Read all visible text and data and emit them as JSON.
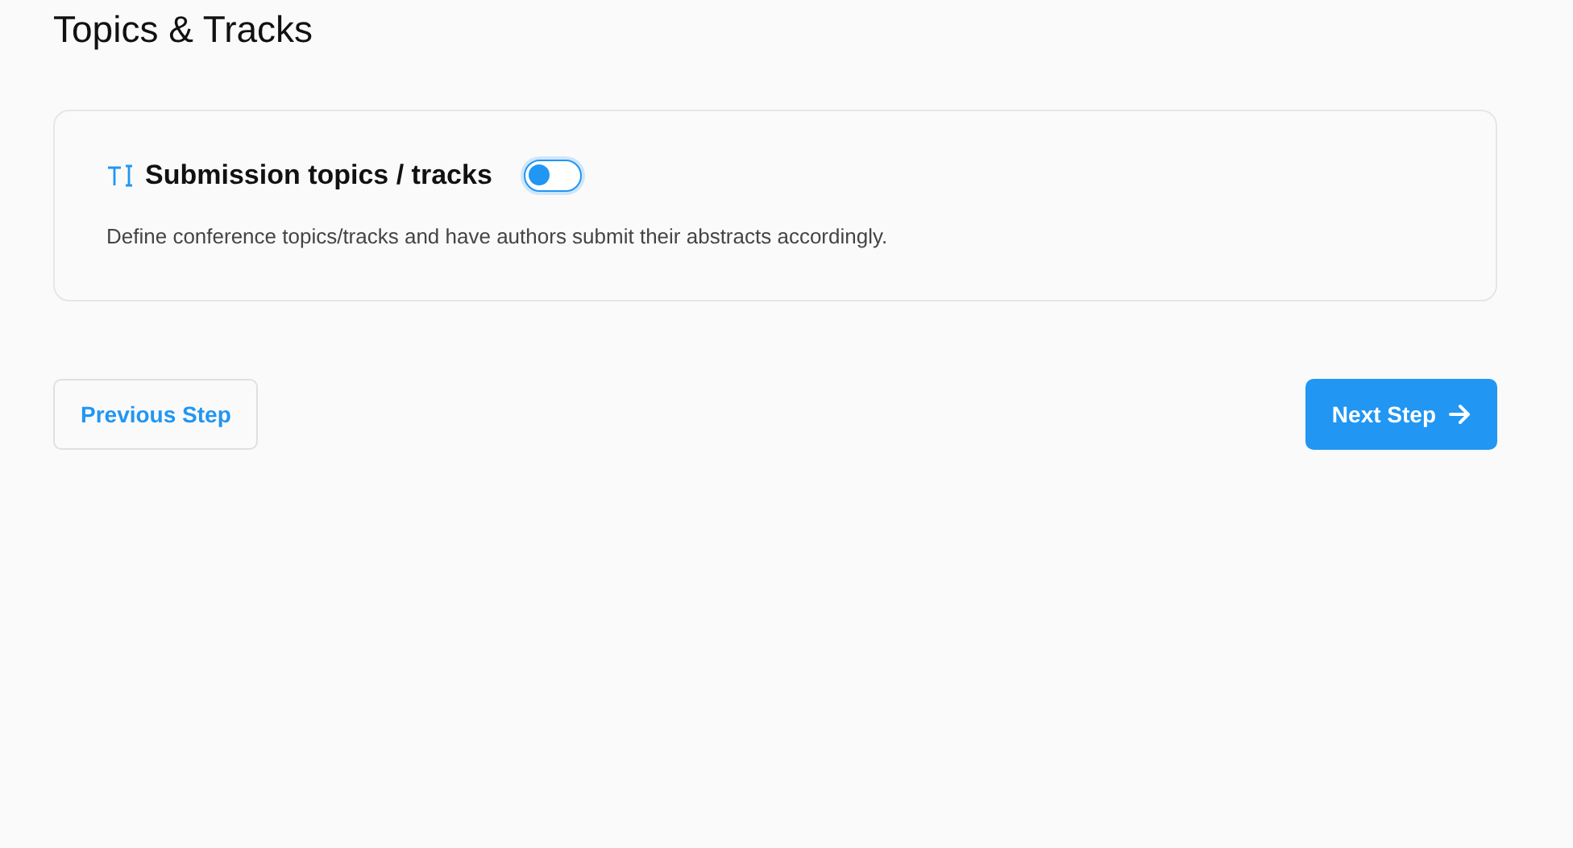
{
  "page_title": "Topics & Tracks",
  "setting": {
    "title": "Submission topics / tracks",
    "on": false,
    "description": "Define conference topics/tracks and have authors submit their abstracts accordingly."
  },
  "buttons": [
    {
      "kind": "secondary",
      "label": "Previous Step"
    },
    {
      "kind": "primary",
      "label": "Next Step"
    }
  ]
}
